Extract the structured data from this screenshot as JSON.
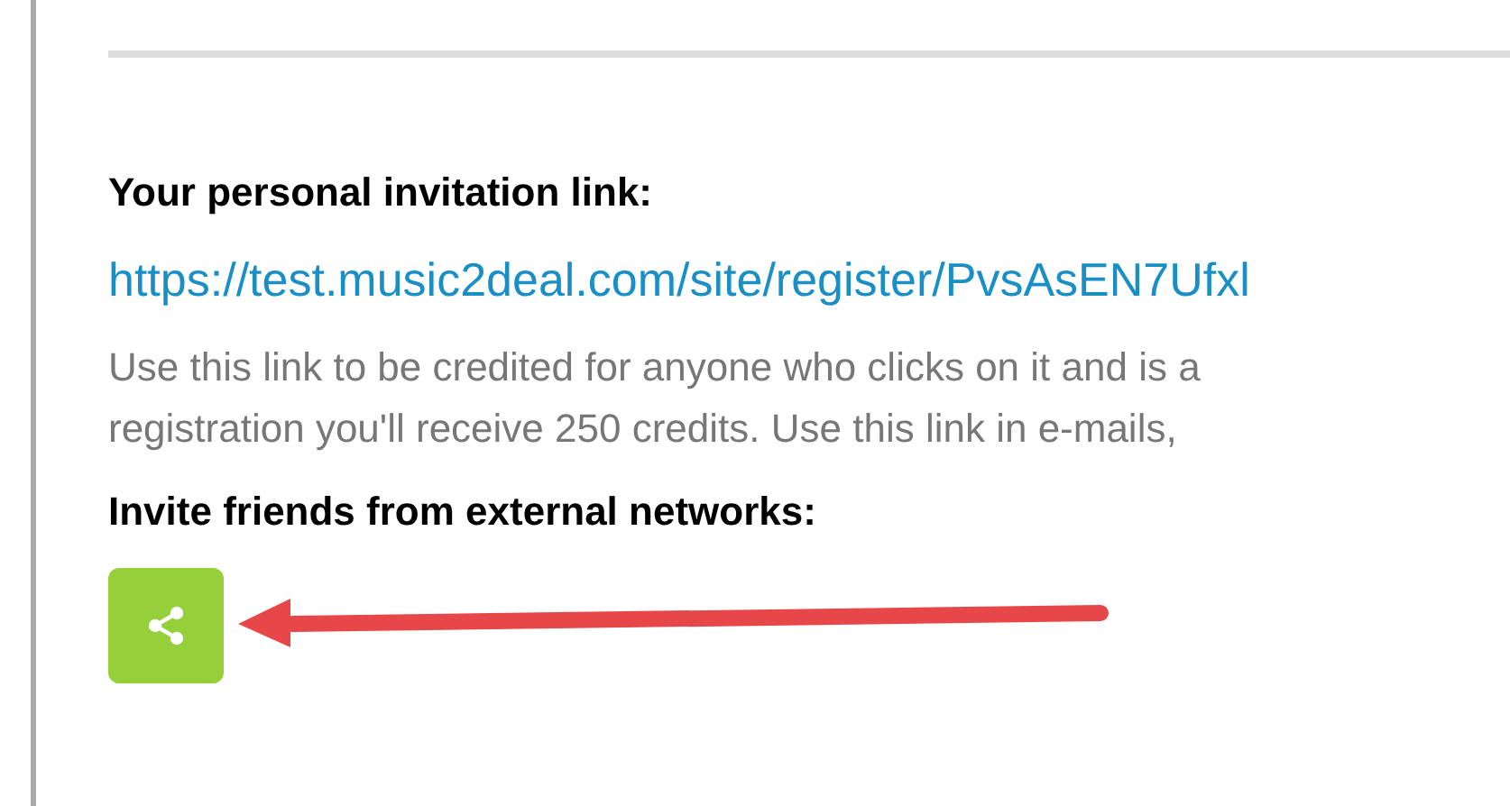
{
  "invitation_heading": "Your personal invitation link:",
  "invitation_link": "https://test.music2deal.com/site/register/PvsAsEN7Ufxl",
  "description_lines": [
    "Use this link to be credited for anyone who clicks on it and is a",
    "registration you'll receive 250 credits. Use this link in e-mails,"
  ],
  "networks_heading": "Invite friends from external networks:"
}
